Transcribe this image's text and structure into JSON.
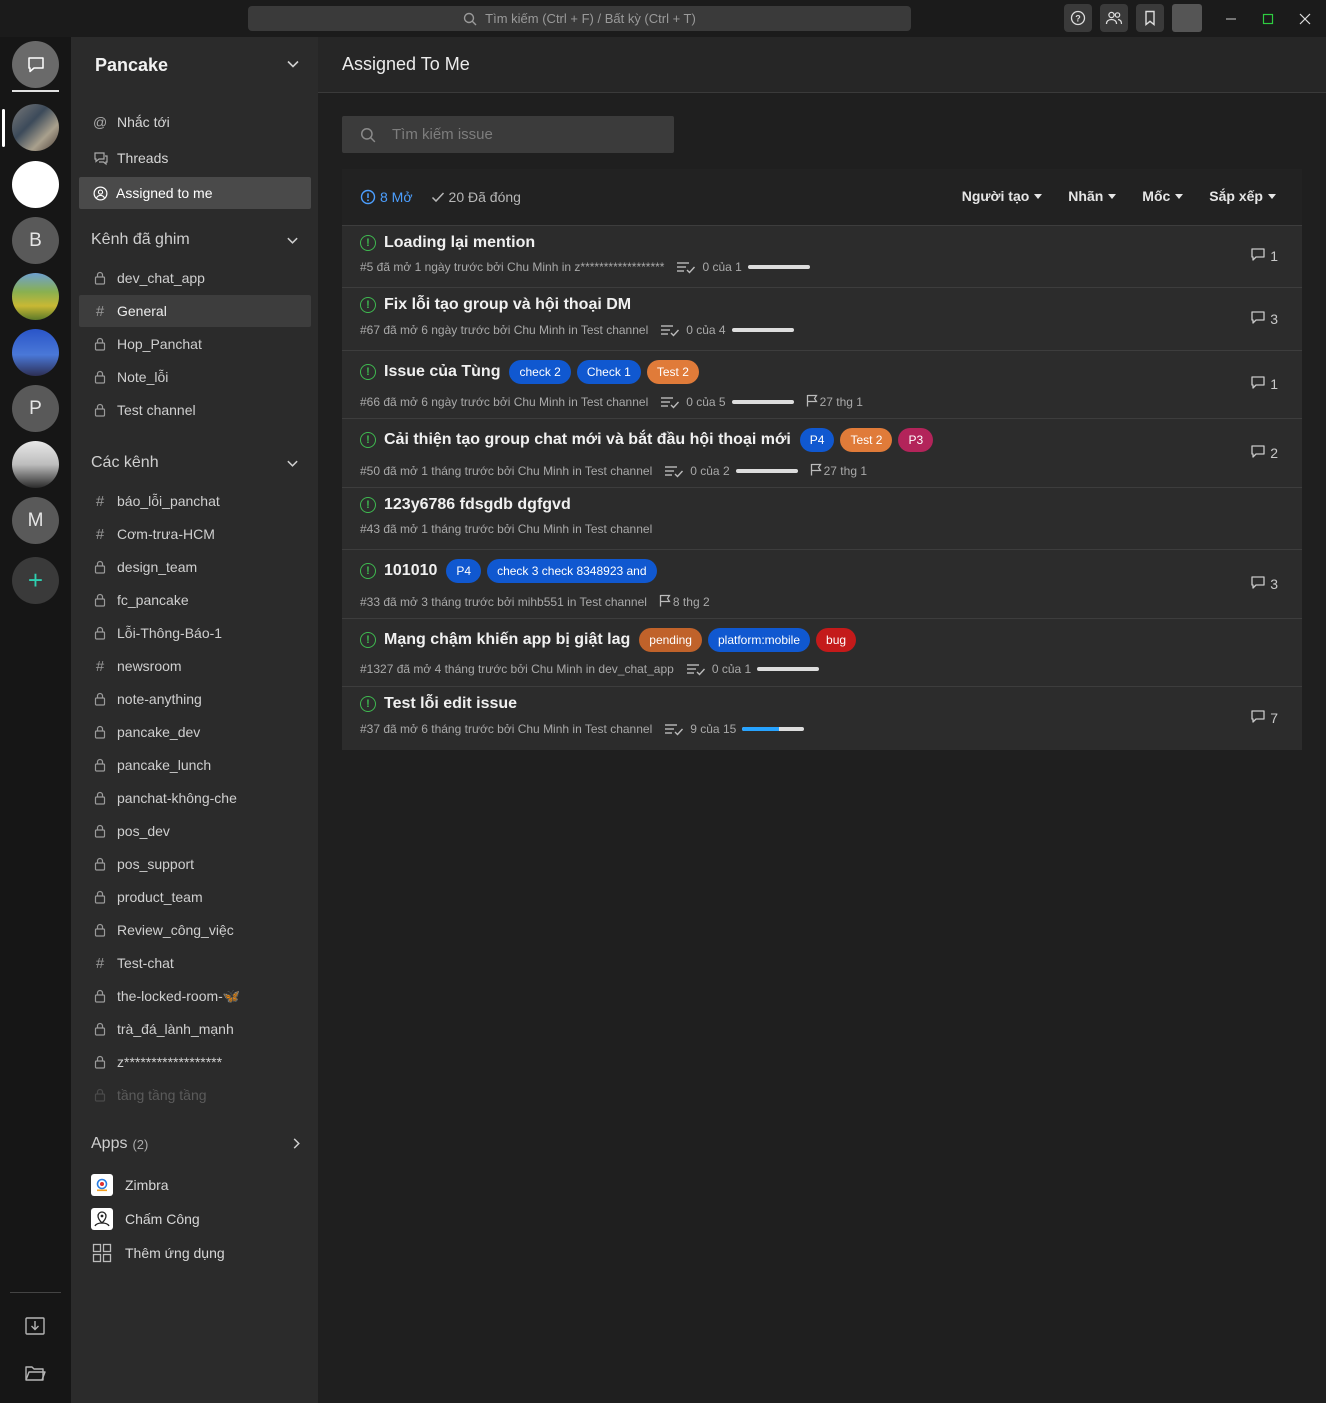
{
  "titlebar": {
    "search_placeholder": "Tìm kiếm (Ctrl + F) / Bất kỳ (Ctrl + T)"
  },
  "rail": {
    "letters": [
      "B",
      "P",
      "M"
    ],
    "add": "+"
  },
  "sidebar": {
    "workspace": "Pancake",
    "nav": {
      "mentions": "Nhắc tới",
      "threads": "Threads",
      "assigned": "Assigned to me"
    },
    "pinned_title": "Kênh đã ghim",
    "pinned": [
      {
        "name": "dev_chat_app",
        "icon": "lock-icon"
      },
      {
        "name": "General",
        "icon": "hash-icon"
      },
      {
        "name": "Hop_Panchat",
        "icon": "lock-icon"
      },
      {
        "name": "Note_lỗi",
        "icon": "lock-icon"
      },
      {
        "name": "Test channel",
        "icon": "lock-icon"
      }
    ],
    "channels_title": "Các kênh",
    "channels": [
      {
        "name": "báo_lỗi_panchat",
        "icon": "hash-icon"
      },
      {
        "name": "Cơm-trưa-HCM",
        "icon": "hash-icon"
      },
      {
        "name": "design_team",
        "icon": "lock-icon"
      },
      {
        "name": "fc_pancake",
        "icon": "lock-icon"
      },
      {
        "name": "Lỗi-Thông-Báo-1",
        "icon": "lock-icon"
      },
      {
        "name": "newsroom",
        "icon": "hash-icon"
      },
      {
        "name": "note-anything",
        "icon": "lock-icon"
      },
      {
        "name": "pancake_dev",
        "icon": "lock-icon"
      },
      {
        "name": "pancake_lunch",
        "icon": "lock-icon"
      },
      {
        "name": "panchat-không-che",
        "icon": "lock-icon"
      },
      {
        "name": "pos_dev",
        "icon": "lock-icon"
      },
      {
        "name": "pos_support",
        "icon": "lock-icon"
      },
      {
        "name": "product_team",
        "icon": "lock-icon"
      },
      {
        "name": "Review_công_việc",
        "icon": "lock-icon"
      },
      {
        "name": "Test-chat",
        "icon": "hash-icon"
      },
      {
        "name": "the-locked-room-🦋",
        "icon": "lock-icon"
      },
      {
        "name": "trà_đá_lành_mạnh",
        "icon": "lock-icon"
      },
      {
        "name": "z******************",
        "icon": "lock-icon"
      },
      {
        "name": "tầng tầng tầng",
        "icon": "lock-icon"
      }
    ],
    "apps_title": "Apps",
    "apps_count": "(2)",
    "apps": [
      {
        "name": "Zimbra",
        "icon": "zimbra-icon"
      },
      {
        "name": "Chấm Công",
        "icon": "timekeeping-icon"
      },
      {
        "name": "Thêm ứng dụng",
        "icon": "add-app-grid-icon"
      }
    ]
  },
  "main": {
    "title": "Assigned To Me",
    "search_placeholder": "Tìm kiếm issue",
    "open_count": "8 Mở",
    "closed_count": "20 Đã đóng",
    "filters": [
      "Người tạo",
      "Nhãn",
      "Mốc",
      "Sắp xếp"
    ],
    "issues": [
      {
        "title": "Loading lại mention",
        "labels": [],
        "meta": "#5 đã mở 1 ngày trước bởi Chu Minh  in z******************",
        "tasks": "0 của 1",
        "progress": 0,
        "milestone": "",
        "comments": "1"
      },
      {
        "title": "Fix lỗi tạo group và hội thoại DM",
        "labels": [],
        "meta": "#67 đã mở 6 ngày trước bởi Chu Minh  in Test channel",
        "tasks": "0 của 4",
        "progress": 0,
        "milestone": "",
        "comments": "3"
      },
      {
        "title": "Issue của Tùng",
        "labels": [
          {
            "text": "check 2",
            "color": "#1058d0"
          },
          {
            "text": "Check 1",
            "color": "#1058d0"
          },
          {
            "text": "Test 2",
            "color": "#e07b39"
          }
        ],
        "meta": "#66 đã mở 6 ngày trước bởi Chu Minh  in Test channel",
        "tasks": "0 của 5",
        "progress": 0,
        "milestone": "27 thg 1",
        "comments": "1"
      },
      {
        "title": "Cải thiện tạo group chat mới và bắt đầu hội thoại mới",
        "labels": [
          {
            "text": "P4",
            "color": "#1058d0"
          },
          {
            "text": "Test 2",
            "color": "#e07b39"
          },
          {
            "text": "P3",
            "color": "#b3245a"
          }
        ],
        "meta": "#50 đã mở 1 tháng trước bởi Chu Minh  in Test channel",
        "tasks": "0 của 2",
        "progress": 0,
        "milestone": "27 thg 1",
        "comments": "2"
      },
      {
        "title": "123y6786 fdsgdb dgfgvd",
        "labels": [],
        "meta": "#43 đã mở 1 tháng trước bởi Chu Minh  in Test channel",
        "tasks": "",
        "progress": 0,
        "milestone": "",
        "comments": ""
      },
      {
        "title": "101010",
        "labels": [
          {
            "text": "P4",
            "color": "#1058d0"
          },
          {
            "text": "check 3 check 8348923 and",
            "color": "#1058d0"
          }
        ],
        "meta": "#33 đã mở 3 tháng trước bởi mihb551  in Test channel",
        "tasks": "",
        "progress": 0,
        "milestone": "8 thg 2",
        "comments": "3"
      },
      {
        "title": "Mạng chậm khiến app bị giật lag",
        "labels": [
          {
            "text": "pending",
            "color": "#c0622a"
          },
          {
            "text": "platform:mobile",
            "color": "#1058d0"
          },
          {
            "text": "bug",
            "color": "#c41a1a"
          }
        ],
        "meta": "#1327 đã mở 4 tháng trước bởi Chu Minh  in dev_chat_app",
        "tasks": "0 của 1",
        "progress": 0,
        "milestone": "",
        "comments": ""
      },
      {
        "title": "Test lỗi edit issue",
        "labels": [],
        "meta": "#37 đã mở 6 tháng trước bởi Chu Minh  in Test channel",
        "tasks": "9 của 15",
        "progress": 0.6,
        "milestone": "",
        "comments": "7"
      }
    ]
  }
}
